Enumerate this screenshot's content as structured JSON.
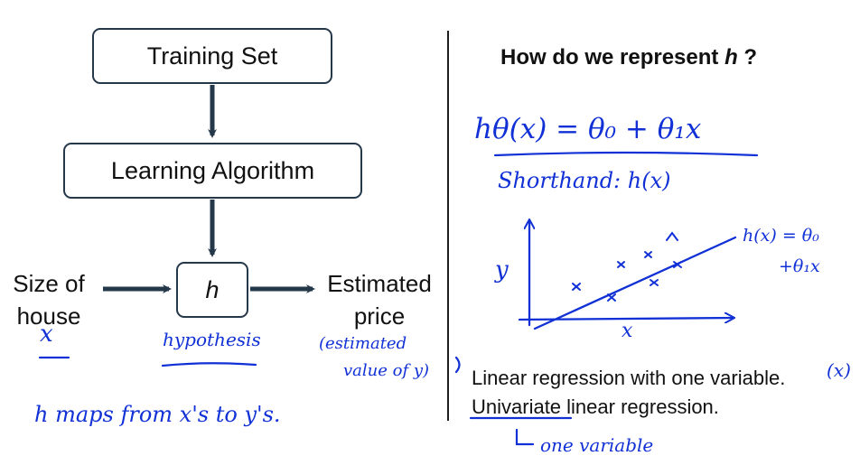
{
  "flow": {
    "training_set": "Training Set",
    "learning_algorithm": "Learning Algorithm",
    "hypothesis_symbol": "h",
    "input_label": "Size of\nhouse",
    "output_label": "Estimated\nprice"
  },
  "right": {
    "question_prefix": "How do we represent ",
    "question_h": "h",
    "question_suffix": " ?",
    "linear_regression": "Linear regression with one variable.",
    "univariate_word": "Univariate",
    "univariate_rest": " linear regression."
  },
  "annotations": {
    "x_under_input": "x",
    "hypothesis": "hypothesis",
    "estimated_line1": "(estimated",
    "estimated_line2": "value of y)",
    "h_maps": "h maps from x's to y's.",
    "formula": "hθ(x) = θ₀ + θ₁x",
    "shorthand": "Shorthand: h(x)",
    "y_axis": "y",
    "x_axis": "x",
    "graph_formula_line1": "h(x) = θ₀",
    "graph_formula_line2": "+θ₁x",
    "x_paren": "(x)",
    "one_variable": "one variable"
  },
  "colors": {
    "box_border": "#25384a",
    "arrow": "#25384a",
    "ink": "#1131d6",
    "text": "#111111"
  }
}
